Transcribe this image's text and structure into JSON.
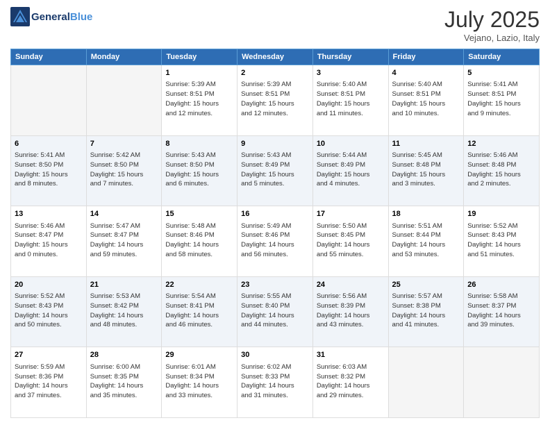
{
  "header": {
    "logo_line1": "General",
    "logo_line2": "Blue",
    "month": "July 2025",
    "location": "Vejano, Lazio, Italy"
  },
  "weekdays": [
    "Sunday",
    "Monday",
    "Tuesday",
    "Wednesday",
    "Thursday",
    "Friday",
    "Saturday"
  ],
  "weeks": [
    [
      {
        "date": "",
        "content": ""
      },
      {
        "date": "",
        "content": ""
      },
      {
        "date": "1",
        "content": "Sunrise: 5:39 AM\nSunset: 8:51 PM\nDaylight: 15 hours\nand 12 minutes."
      },
      {
        "date": "2",
        "content": "Sunrise: 5:39 AM\nSunset: 8:51 PM\nDaylight: 15 hours\nand 12 minutes."
      },
      {
        "date": "3",
        "content": "Sunrise: 5:40 AM\nSunset: 8:51 PM\nDaylight: 15 hours\nand 11 minutes."
      },
      {
        "date": "4",
        "content": "Sunrise: 5:40 AM\nSunset: 8:51 PM\nDaylight: 15 hours\nand 10 minutes."
      },
      {
        "date": "5",
        "content": "Sunrise: 5:41 AM\nSunset: 8:51 PM\nDaylight: 15 hours\nand 9 minutes."
      }
    ],
    [
      {
        "date": "6",
        "content": "Sunrise: 5:41 AM\nSunset: 8:50 PM\nDaylight: 15 hours\nand 8 minutes."
      },
      {
        "date": "7",
        "content": "Sunrise: 5:42 AM\nSunset: 8:50 PM\nDaylight: 15 hours\nand 7 minutes."
      },
      {
        "date": "8",
        "content": "Sunrise: 5:43 AM\nSunset: 8:50 PM\nDaylight: 15 hours\nand 6 minutes."
      },
      {
        "date": "9",
        "content": "Sunrise: 5:43 AM\nSunset: 8:49 PM\nDaylight: 15 hours\nand 5 minutes."
      },
      {
        "date": "10",
        "content": "Sunrise: 5:44 AM\nSunset: 8:49 PM\nDaylight: 15 hours\nand 4 minutes."
      },
      {
        "date": "11",
        "content": "Sunrise: 5:45 AM\nSunset: 8:48 PM\nDaylight: 15 hours\nand 3 minutes."
      },
      {
        "date": "12",
        "content": "Sunrise: 5:46 AM\nSunset: 8:48 PM\nDaylight: 15 hours\nand 2 minutes."
      }
    ],
    [
      {
        "date": "13",
        "content": "Sunrise: 5:46 AM\nSunset: 8:47 PM\nDaylight: 15 hours\nand 0 minutes."
      },
      {
        "date": "14",
        "content": "Sunrise: 5:47 AM\nSunset: 8:47 PM\nDaylight: 14 hours\nand 59 minutes."
      },
      {
        "date": "15",
        "content": "Sunrise: 5:48 AM\nSunset: 8:46 PM\nDaylight: 14 hours\nand 58 minutes."
      },
      {
        "date": "16",
        "content": "Sunrise: 5:49 AM\nSunset: 8:46 PM\nDaylight: 14 hours\nand 56 minutes."
      },
      {
        "date": "17",
        "content": "Sunrise: 5:50 AM\nSunset: 8:45 PM\nDaylight: 14 hours\nand 55 minutes."
      },
      {
        "date": "18",
        "content": "Sunrise: 5:51 AM\nSunset: 8:44 PM\nDaylight: 14 hours\nand 53 minutes."
      },
      {
        "date": "19",
        "content": "Sunrise: 5:52 AM\nSunset: 8:43 PM\nDaylight: 14 hours\nand 51 minutes."
      }
    ],
    [
      {
        "date": "20",
        "content": "Sunrise: 5:52 AM\nSunset: 8:43 PM\nDaylight: 14 hours\nand 50 minutes."
      },
      {
        "date": "21",
        "content": "Sunrise: 5:53 AM\nSunset: 8:42 PM\nDaylight: 14 hours\nand 48 minutes."
      },
      {
        "date": "22",
        "content": "Sunrise: 5:54 AM\nSunset: 8:41 PM\nDaylight: 14 hours\nand 46 minutes."
      },
      {
        "date": "23",
        "content": "Sunrise: 5:55 AM\nSunset: 8:40 PM\nDaylight: 14 hours\nand 44 minutes."
      },
      {
        "date": "24",
        "content": "Sunrise: 5:56 AM\nSunset: 8:39 PM\nDaylight: 14 hours\nand 43 minutes."
      },
      {
        "date": "25",
        "content": "Sunrise: 5:57 AM\nSunset: 8:38 PM\nDaylight: 14 hours\nand 41 minutes."
      },
      {
        "date": "26",
        "content": "Sunrise: 5:58 AM\nSunset: 8:37 PM\nDaylight: 14 hours\nand 39 minutes."
      }
    ],
    [
      {
        "date": "27",
        "content": "Sunrise: 5:59 AM\nSunset: 8:36 PM\nDaylight: 14 hours\nand 37 minutes."
      },
      {
        "date": "28",
        "content": "Sunrise: 6:00 AM\nSunset: 8:35 PM\nDaylight: 14 hours\nand 35 minutes."
      },
      {
        "date": "29",
        "content": "Sunrise: 6:01 AM\nSunset: 8:34 PM\nDaylight: 14 hours\nand 33 minutes."
      },
      {
        "date": "30",
        "content": "Sunrise: 6:02 AM\nSunset: 8:33 PM\nDaylight: 14 hours\nand 31 minutes."
      },
      {
        "date": "31",
        "content": "Sunrise: 6:03 AM\nSunset: 8:32 PM\nDaylight: 14 hours\nand 29 minutes."
      },
      {
        "date": "",
        "content": ""
      },
      {
        "date": "",
        "content": ""
      }
    ]
  ]
}
